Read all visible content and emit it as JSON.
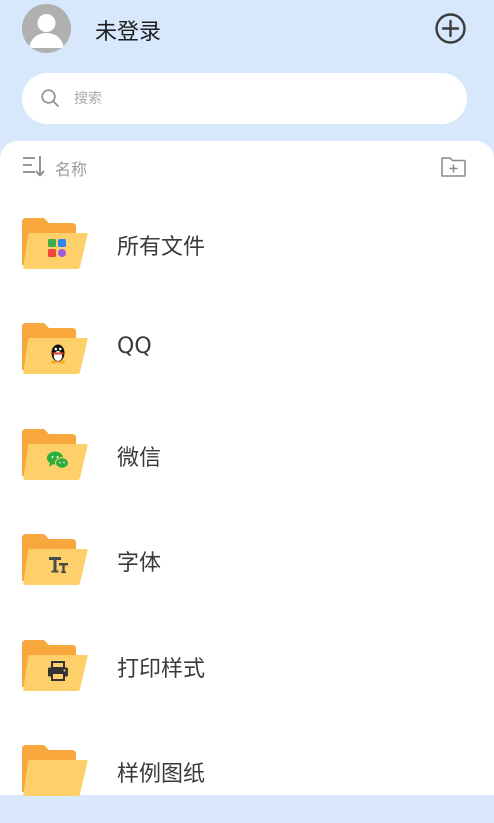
{
  "header": {
    "user_name": "未登录"
  },
  "search": {
    "placeholder": "搜索"
  },
  "sort": {
    "label": "名称"
  },
  "folders": [
    {
      "label": "所有文件",
      "badge": "grid-apps-icon"
    },
    {
      "label": "QQ",
      "badge": "qq-penguin-icon"
    },
    {
      "label": "微信",
      "badge": "wechat-icon"
    },
    {
      "label": "字体",
      "badge": "font-icon"
    },
    {
      "label": "打印样式",
      "badge": "printer-icon"
    },
    {
      "label": "样例图纸",
      "badge": ""
    }
  ],
  "colors": {
    "header_bg": "#d8e8fc",
    "folder_back": "#f7a73b",
    "folder_front": "#fdd06a",
    "text_primary": "#3a3a3a",
    "text_muted": "#9a9a9a"
  }
}
